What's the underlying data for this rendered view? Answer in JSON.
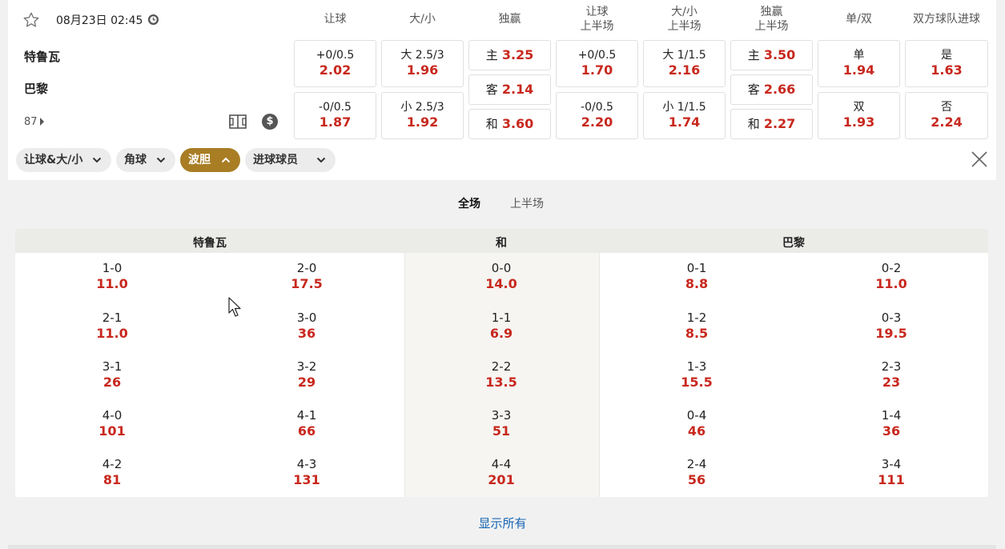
{
  "match": {
    "datetime": "08月23日 02:45",
    "home": "特鲁瓦",
    "away": "巴黎",
    "more_count": "87"
  },
  "market_headers": [
    {
      "line1": "让球",
      "line2": ""
    },
    {
      "line1": "大/小",
      "line2": ""
    },
    {
      "line1": "独赢",
      "line2": ""
    },
    {
      "line1": "让球",
      "line2": "上半场"
    },
    {
      "line1": "大/小",
      "line2": "上半场"
    },
    {
      "line1": "独赢",
      "line2": "上半场"
    },
    {
      "line1": "单/双",
      "line2": ""
    },
    {
      "line1": "双方球队进球",
      "line2": ""
    }
  ],
  "markets": {
    "handicap": [
      {
        "label": "+0/0.5",
        "odds": "2.02"
      },
      {
        "label": "-0/0.5",
        "odds": "1.87"
      }
    ],
    "over_under": [
      {
        "label": "大 2.5/3",
        "odds": "1.96"
      },
      {
        "label": "小 2.5/3",
        "odds": "1.92"
      }
    ],
    "moneyline": [
      {
        "label": "主",
        "odds": "3.25"
      },
      {
        "label": "客",
        "odds": "2.14"
      },
      {
        "label": "和",
        "odds": "3.60"
      }
    ],
    "handicap_1h": [
      {
        "label": "+0/0.5",
        "odds": "1.70"
      },
      {
        "label": "-0/0.5",
        "odds": "2.20"
      }
    ],
    "over_under_1h": [
      {
        "label": "大 1/1.5",
        "odds": "2.16"
      },
      {
        "label": "小 1/1.5",
        "odds": "1.74"
      }
    ],
    "moneyline_1h": [
      {
        "label": "主",
        "odds": "3.50"
      },
      {
        "label": "客",
        "odds": "2.66"
      },
      {
        "label": "和",
        "odds": "2.27"
      }
    ],
    "odd_even": [
      {
        "label": "单",
        "odds": "1.94"
      },
      {
        "label": "双",
        "odds": "1.93"
      }
    ],
    "btts": [
      {
        "label": "是",
        "odds": "1.63"
      },
      {
        "label": "否",
        "odds": "2.24"
      }
    ]
  },
  "filters": [
    {
      "label": "让球&大/小",
      "active": false
    },
    {
      "label": "角球",
      "active": false
    },
    {
      "label": "波胆",
      "active": true
    },
    {
      "label": "进球球员",
      "active": false
    }
  ],
  "tabs": [
    {
      "label": "全场",
      "active": true
    },
    {
      "label": "上半场",
      "active": false
    }
  ],
  "correct_score": {
    "headers": {
      "home": "特鲁瓦",
      "draw": "和",
      "away": "巴黎"
    },
    "columns": [
      [
        {
          "s": "1-0",
          "o": "11.0"
        },
        {
          "s": "2-1",
          "o": "11.0"
        },
        {
          "s": "3-1",
          "o": "26"
        },
        {
          "s": "4-0",
          "o": "101"
        },
        {
          "s": "4-2",
          "o": "81"
        }
      ],
      [
        {
          "s": "2-0",
          "o": "17.5"
        },
        {
          "s": "3-0",
          "o": "36"
        },
        {
          "s": "3-2",
          "o": "29"
        },
        {
          "s": "4-1",
          "o": "66"
        },
        {
          "s": "4-3",
          "o": "131"
        }
      ],
      [
        {
          "s": "0-0",
          "o": "14.0"
        },
        {
          "s": "1-1",
          "o": "6.9"
        },
        {
          "s": "2-2",
          "o": "13.5"
        },
        {
          "s": "3-3",
          "o": "51"
        },
        {
          "s": "4-4",
          "o": "201"
        }
      ],
      [
        {
          "s": "0-1",
          "o": "8.8"
        },
        {
          "s": "1-2",
          "o": "8.5"
        },
        {
          "s": "1-3",
          "o": "15.5"
        },
        {
          "s": "0-4",
          "o": "46"
        },
        {
          "s": "2-4",
          "o": "56"
        }
      ],
      [
        {
          "s": "0-2",
          "o": "11.0"
        },
        {
          "s": "0-3",
          "o": "19.5"
        },
        {
          "s": "2-3",
          "o": "23"
        },
        {
          "s": "1-4",
          "o": "36"
        },
        {
          "s": "3-4",
          "o": "111"
        }
      ]
    ]
  },
  "show_all": "显示所有",
  "colors": {
    "odds": "#c8281e",
    "accent": "#a87d24",
    "link": "#1665b3"
  }
}
